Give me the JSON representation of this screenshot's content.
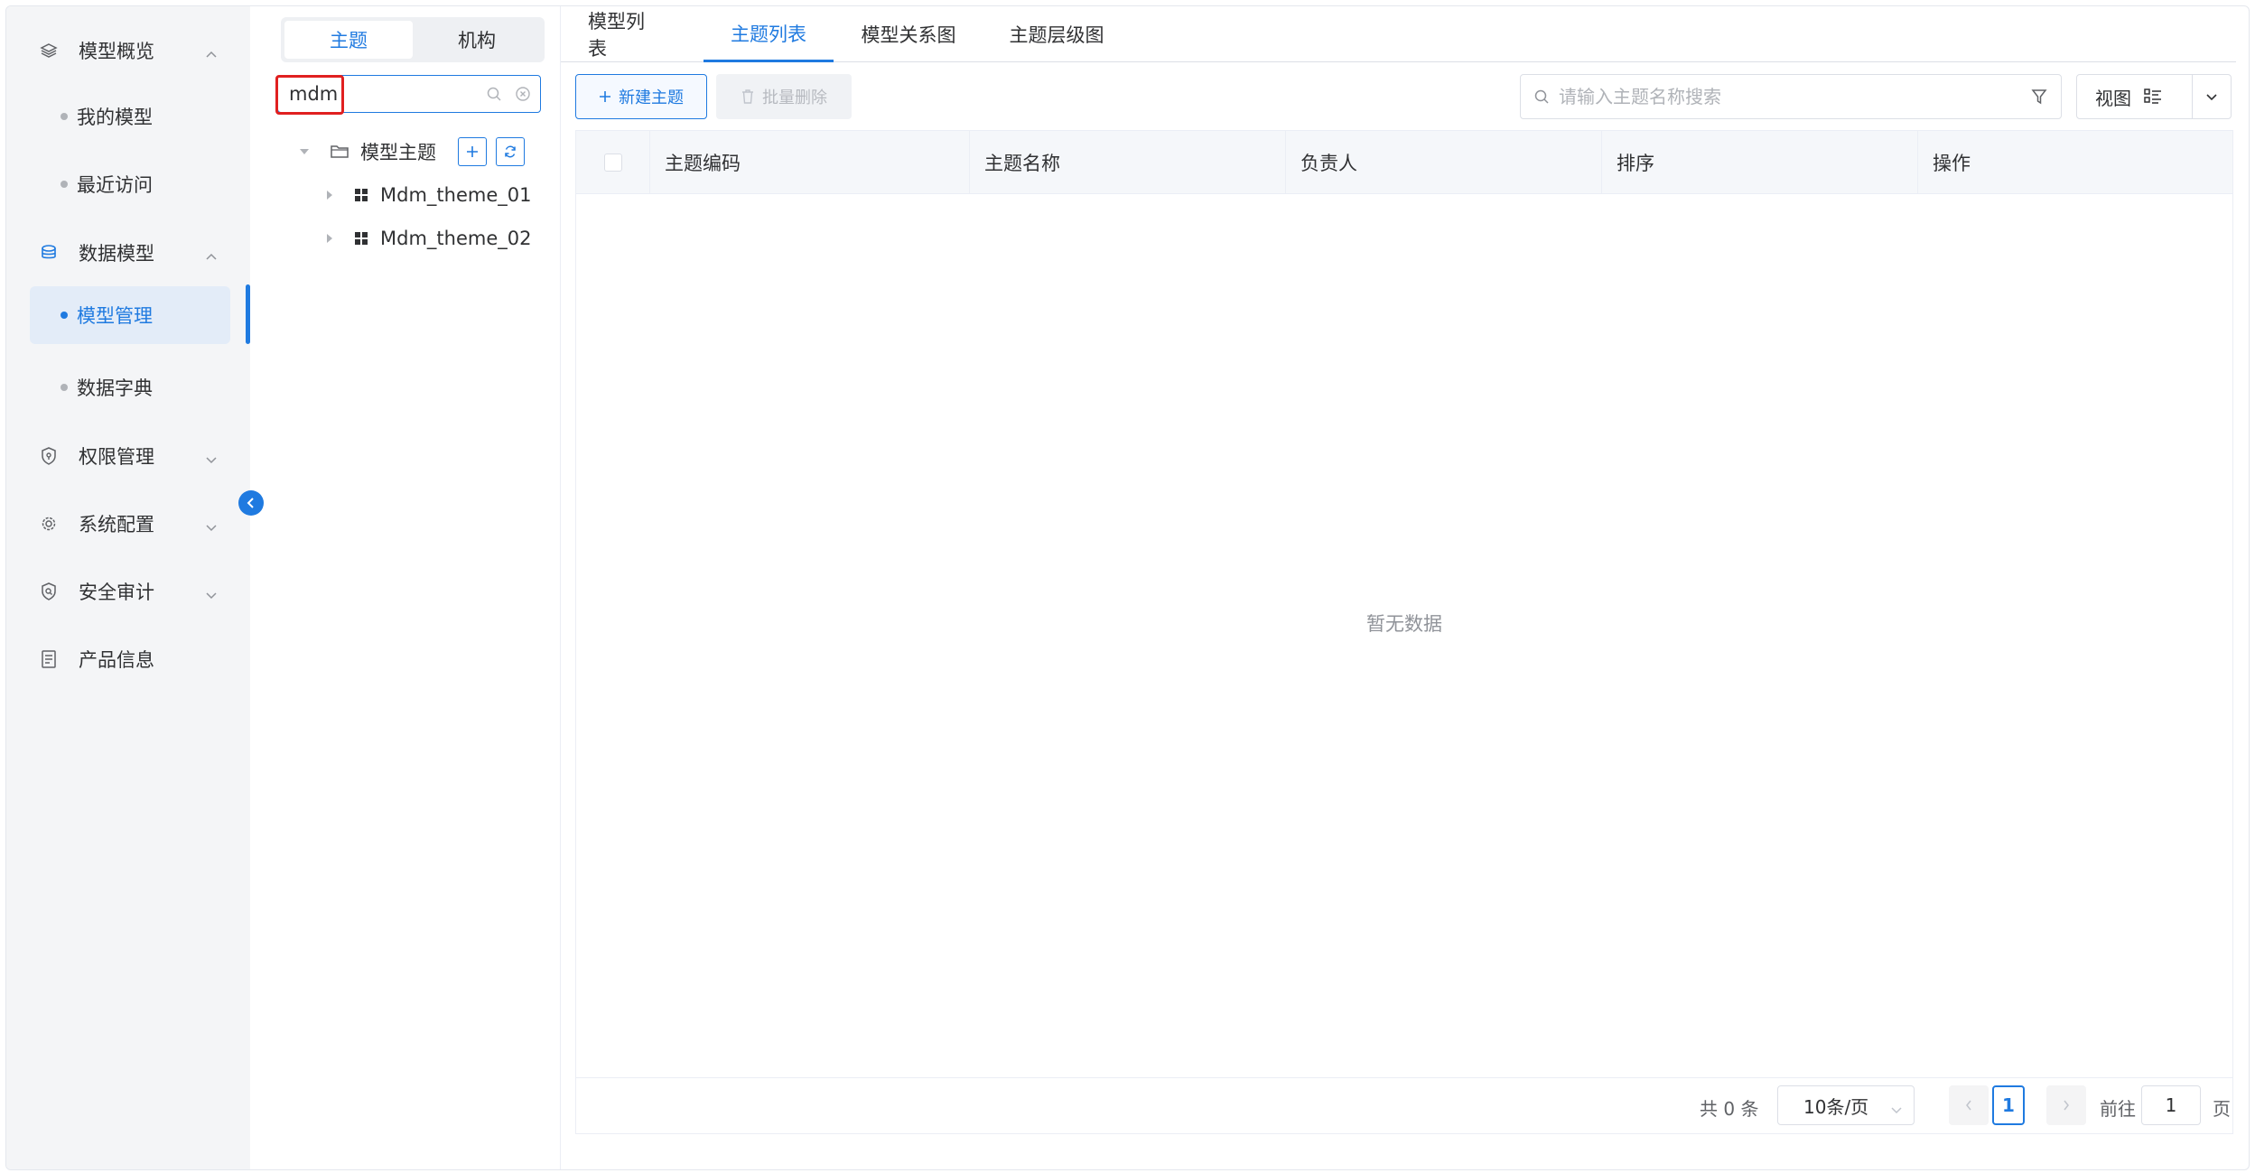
{
  "sidebar": {
    "items": [
      {
        "label": "模型概览",
        "icon": "layers-icon",
        "chevron": "up"
      },
      {
        "label": "数据模型",
        "icon": "database-icon",
        "chevron": "up"
      },
      {
        "label": "权限管理",
        "icon": "shield-icon",
        "chevron": "down"
      },
      {
        "label": "系统配置",
        "icon": "gear-icon",
        "chevron": "down"
      },
      {
        "label": "安全审计",
        "icon": "audit-shield-icon",
        "chevron": "down"
      },
      {
        "label": "产品信息",
        "icon": "document-icon",
        "chevron": ""
      }
    ],
    "sub_items": [
      {
        "label": "我的模型"
      },
      {
        "label": "最近访问"
      },
      {
        "label": "模型管理",
        "active": true
      },
      {
        "label": "数据字典"
      }
    ]
  },
  "tree": {
    "segments": [
      "主题",
      "机构"
    ],
    "search_value": "mdm",
    "root_label": "模型主题",
    "nodes": [
      "Mdm_theme_01",
      "Mdm_theme_02"
    ]
  },
  "main": {
    "tabs": [
      "模型列表",
      "主题列表",
      "模型关系图",
      "主题层级图"
    ],
    "active_tab": "主题列表",
    "new_button": "新建主题",
    "batch_delete_button": "批量删除",
    "search_placeholder": "请输入主题名称搜索",
    "view_label": "视图",
    "columns": [
      "主题编码",
      "主题名称",
      "负责人",
      "排序",
      "操作"
    ],
    "empty_text": "暂无数据",
    "pagination": {
      "total": "共 0 条",
      "page_size": "10条/页",
      "current_page": "1",
      "goto_label": "前往",
      "goto_value": "1",
      "page_suffix": "页"
    }
  },
  "colors": {
    "accent": "#1f7ae0",
    "highlight": "#e02020"
  }
}
